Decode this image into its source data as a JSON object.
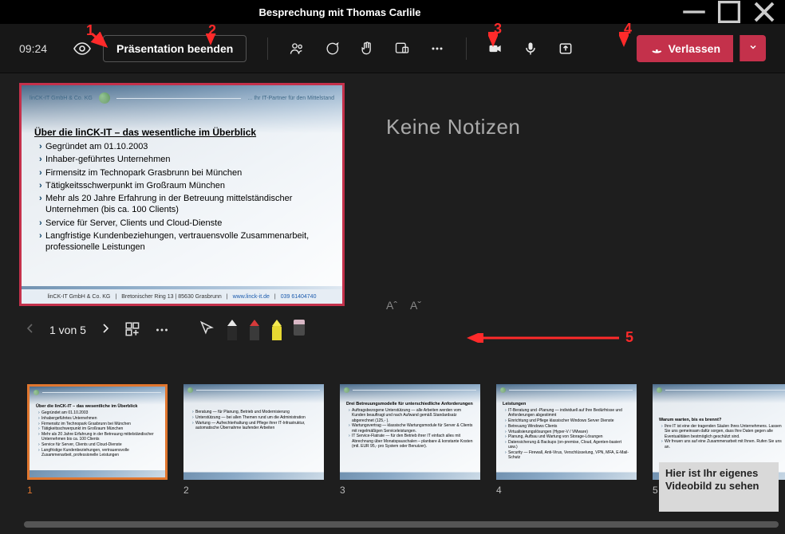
{
  "titlebar": {
    "title": "Besprechung mit Thomas Carlile"
  },
  "toolbar": {
    "time": "09:24",
    "stop_presentation_label": "Präsentation beenden",
    "leave_label": "Verlassen"
  },
  "notes": {
    "heading": "Keine Notizen",
    "font_increase": "Aˆ",
    "font_decrease": "Aˇ"
  },
  "slide_nav": {
    "page_indicator": "1 von 5"
  },
  "annotations": {
    "n1": "1",
    "n2": "2",
    "n3": "3",
    "n4": "4",
    "n5": "5"
  },
  "self_video": {
    "text": "Hier ist Ihr eigenes Videobild zu sehen"
  },
  "main_slide": {
    "header_left": "linCK-IT GmbH & Co. KG",
    "header_right": "... Ihr IT-Partner für den Mittelstand",
    "title": "Über die linCK-IT – das wesentliche im Überblick",
    "bullets": [
      "Gegründet am 01.10.2003",
      "Inhaber-geführtes Unternehmen",
      "Firmensitz im Technopark Grasbrunn bei München",
      "Tätigkeitsschwerpunkt im Großraum München",
      "Mehr als 20 Jahre Erfahrung in der Betreuung  mittelständischer Unternehmen (bis ca. 100 Clients)",
      "Service für Server, Clients und Cloud-Dienste",
      "Langfristige Kundenbeziehungen, vertrauensvolle Zusammenarbeit, professionelle Leistungen"
    ],
    "footer_company": "linCK-IT GmbH & Co. KG",
    "footer_address": "Bretonischer Ring 13 | 85630 Grasbrunn",
    "footer_web": "www.linck-it.de",
    "footer_tel": "039 61404740"
  },
  "thumbs": [
    {
      "num": "1",
      "title": "Über die linCK-IT – das wesentliche im Überblick",
      "bullets": [
        "Gegründet am 01.10.2003",
        "Inhabergeführtes Unternehmen",
        "Firmensitz im Technopark Grasbrunn bei München",
        "Tätigkeitsschwerpunkt im Großraum München",
        "Mehr als 20 Jahre Erfahrung in der Betreuung mittelständischer Unternehmen bis ca. 100 Clients",
        "Service für Server, Clients und Cloud-Dienste",
        "Langfristige Kundenbeziehungen, vertrauensvolle Zusammenarbeit, professionelle Leistungen"
      ]
    },
    {
      "num": "2",
      "title": "",
      "bullets": [
        "Beratung — für Planung, Betrieb und Modernisierung",
        "Unterstützung — bei allen Themen rund um die Administration",
        "Wartung — Aufrechterhaltung und Pflege ihrer IT-Infrastruktur, automatische Übernahme laufender Arbeiten"
      ]
    },
    {
      "num": "3",
      "title": "Drei Betreuungsmodelle für unterschiedliche Anforderungen",
      "bullets": [
        "Auftragsbezogene Unterstützung — alle Arbeiten werden vom Kunden beauftragt und nach Aufwand gemäß Standardsatz abgerechnet (125,- ).",
        "Wartungsvertrag — klassische Wartungsmodule für Server & Clients mit regelmäßigen Serviceleistungen.",
        "IT Service-Flatrate — für den Betrieb ihrer IT einfach alles mit Abrechnung über Monatspauschalen – planbare & konstante Kosten (mtl. EUR 95,- pro System oder Benutzer)."
      ]
    },
    {
      "num": "4",
      "title": "Leistungen",
      "bullets": [
        "IT-Beratung und -Planung — individuell auf Ihre Bedürfnisse und Anforderungen abgestimmt",
        "Einrichtung und Pflege klassischer Windows Server Dienste",
        "Betreuung Windows Clients",
        "Virtualisierungslösungen (Hyper-V / VMware)",
        "Planung, Aufbau und Wartung von Storage-Lösungen",
        "Datensicherung & Backups (on-premise, Cloud, Agenten-basiert usw.)",
        "Security — Firewall, Anti-Virus, Verschlüsselung, VPN, MFA, E-Mail-Schutz"
      ]
    },
    {
      "num": "5",
      "title": "Warum warten, bis es brennt?",
      "bullets": [
        "Ihre IT ist eine der tragenden Säulen Ihres Unternehmens. Lassen Sie uns gemeinsam dafür sorgen, dass Ihre Daten gegen alle Eventualitäten bestmöglich geschützt sind.",
        "Wir freuen uns auf eine Zusammenarbeit mit Ihnen. Rufen Sie uns an."
      ]
    }
  ]
}
